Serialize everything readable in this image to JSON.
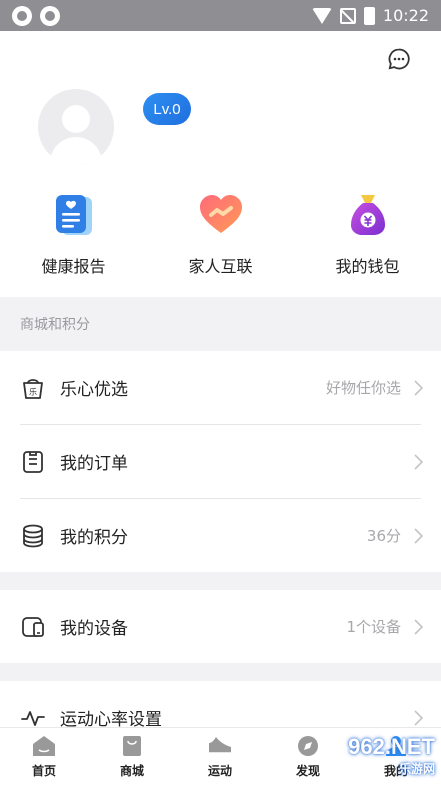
{
  "status_bar": {
    "time": "10:22"
  },
  "profile": {
    "level": "Lv.0"
  },
  "quick_actions": [
    {
      "label": "健康报告",
      "icon": "health-report-icon"
    },
    {
      "label": "家人互联",
      "icon": "family-heart-icon"
    },
    {
      "label": "我的钱包",
      "icon": "wallet-bag-icon"
    }
  ],
  "section": {
    "title": "商城和积分"
  },
  "menu": {
    "mall": {
      "label": "乐心优选",
      "value": "好物任你选",
      "badge": "乐"
    },
    "orders": {
      "label": "我的订单",
      "value": ""
    },
    "points": {
      "label": "我的积分",
      "value": "36分"
    },
    "devices": {
      "label": "我的设备",
      "value": "1个设备"
    },
    "heart_rate": {
      "label": "运动心率设置",
      "value": ""
    }
  },
  "tabs": [
    {
      "label": "首页"
    },
    {
      "label": "商城"
    },
    {
      "label": "运动"
    },
    {
      "label": "发现"
    },
    {
      "label": "我的"
    }
  ],
  "watermark": {
    "main": "962.NET",
    "sub": "乐游网"
  },
  "colors": {
    "accent": "#2e8ff0",
    "background": "#f2f2f4",
    "muted": "#a8a8ac"
  }
}
